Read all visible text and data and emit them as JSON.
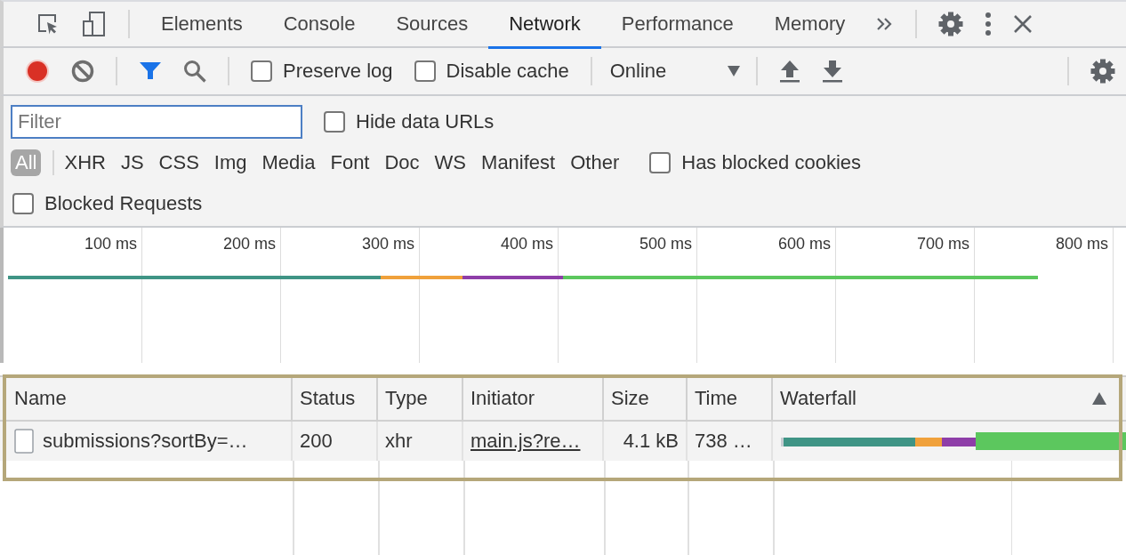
{
  "tabs": [
    {
      "label": "Elements",
      "selected": false
    },
    {
      "label": "Console",
      "selected": false
    },
    {
      "label": "Sources",
      "selected": false
    },
    {
      "label": "Network",
      "selected": true
    },
    {
      "label": "Performance",
      "selected": false
    },
    {
      "label": "Memory",
      "selected": false
    }
  ],
  "toolbar": {
    "recording": true,
    "filter_active": true,
    "preserve_log": {
      "label": "Preserve log",
      "checked": false
    },
    "disable_cache": {
      "label": "Disable cache",
      "checked": false
    },
    "throttling": "Online"
  },
  "filter": {
    "placeholder": "Filter",
    "hide_data_urls": {
      "label": "Hide data URLs",
      "checked": false
    }
  },
  "type_filters": [
    {
      "label": "All",
      "selected": true
    },
    {
      "label": "XHR",
      "selected": false
    },
    {
      "label": "JS",
      "selected": false
    },
    {
      "label": "CSS",
      "selected": false
    },
    {
      "label": "Img",
      "selected": false
    },
    {
      "label": "Media",
      "selected": false
    },
    {
      "label": "Font",
      "selected": false
    },
    {
      "label": "Doc",
      "selected": false
    },
    {
      "label": "WS",
      "selected": false
    },
    {
      "label": "Manifest",
      "selected": false
    },
    {
      "label": "Other",
      "selected": false
    }
  ],
  "has_blocked_cookies": {
    "label": "Has blocked cookies",
    "checked": false
  },
  "blocked_requests": {
    "label": "Blocked Requests",
    "checked": false
  },
  "overview_ticks": [
    "100 ms",
    "200 ms",
    "300 ms",
    "400 ms",
    "500 ms",
    "600 ms",
    "700 ms",
    "800 ms"
  ],
  "table": {
    "columns": [
      {
        "label": "Name",
        "sorted": false
      },
      {
        "label": "Status",
        "sorted": false
      },
      {
        "label": "Type",
        "sorted": false
      },
      {
        "label": "Initiator",
        "sorted": false
      },
      {
        "label": "Size",
        "sorted": false
      },
      {
        "label": "Time",
        "sorted": false
      },
      {
        "label": "Waterfall",
        "sorted": true
      }
    ],
    "rows": [
      {
        "name": "submissions?sortBy=…",
        "status": "200",
        "type": "xhr",
        "initiator": "main.js?re…",
        "size": "4.1 kB",
        "time": "738 …"
      }
    ]
  }
}
